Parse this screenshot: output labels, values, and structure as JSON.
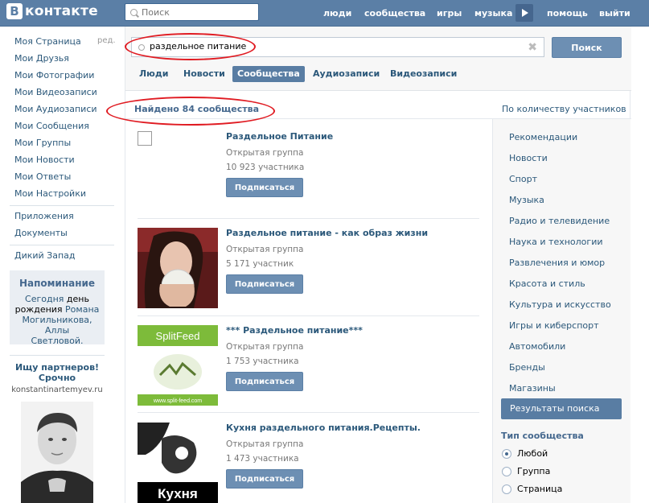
{
  "header": {
    "logo_mark": "B",
    "logo_text": "контакте",
    "search_placeholder": "Поиск",
    "nav": [
      "люди",
      "сообщества",
      "игры",
      "музыка",
      "помощь",
      "выйти"
    ]
  },
  "sidebar": {
    "items": [
      "Моя Страница",
      "Мои Друзья",
      "Мои Фотографии",
      "Мои Видеозаписи",
      "Мои Аудиозаписи",
      "Мои Сообщения",
      "Мои Группы",
      "Мои Новости",
      "Мои Ответы",
      "Мои Настройки"
    ],
    "edit_label": "ред.",
    "extra_items": [
      "Приложения",
      "Документы"
    ],
    "app_item": "Дикий Запад",
    "reminder": {
      "title": "Напоминание",
      "today": "Сегодня",
      "day": "день",
      "birthday": "рождения",
      "name1": "Романа",
      "name2": "Могильникова,",
      "name3": "Аллы",
      "name4": "Светловой."
    },
    "ad": {
      "title": "Ищу партнеров! Срочно",
      "url": "konstantinartemyev.ru"
    }
  },
  "search": {
    "query": "раздельное питание",
    "button_label": "Поиск",
    "tabs": [
      "Люди",
      "Новости",
      "Сообщества",
      "Аудиозаписи",
      "Видеозаписи"
    ],
    "active_tab": "Сообщества",
    "found_text": "Найдено 84 сообщества",
    "sort_label": "По количеству участников"
  },
  "results": [
    {
      "name": "Раздельное Питание",
      "type": "Открытая группа",
      "members": "10 923 участника",
      "button": "Подписаться"
    },
    {
      "name": "Раздельное питание - как образ жизни",
      "type": "Открытая группа",
      "members": "5 171 участник",
      "button": "Подписаться"
    },
    {
      "name": "*** Раздельное питание***",
      "type": "Открытая группа",
      "members": "1 753 участника",
      "button": "Подписаться",
      "thumb_label": "SplitFeed",
      "thumb_url": "www.split-feed.com"
    },
    {
      "name": "Кухня раздельного питания.Рецепты.",
      "type": "Открытая группа",
      "members": "1 473 участника",
      "button": "Подписаться",
      "thumb_label": "Кухня"
    }
  ],
  "filters": {
    "categories": [
      "Рекомендации",
      "Новости",
      "Спорт",
      "Музыка",
      "Радио и телевидение",
      "Наука и технологии",
      "Развлечения и юмор",
      "Красота и стиль",
      "Культура и искусство",
      "Игры и киберспорт",
      "Автомобили",
      "Бренды",
      "Магазины",
      "Результаты поиска"
    ],
    "active_category": "Результаты поиска",
    "type_title": "Тип сообщества",
    "type_options": [
      "Любой",
      "Группа",
      "Страница"
    ],
    "selected_type": "Любой"
  },
  "colors": {
    "header": "#5b7fa6",
    "link": "#2b587a",
    "button": "#6d8fb3",
    "highlight": "#e01b22"
  }
}
